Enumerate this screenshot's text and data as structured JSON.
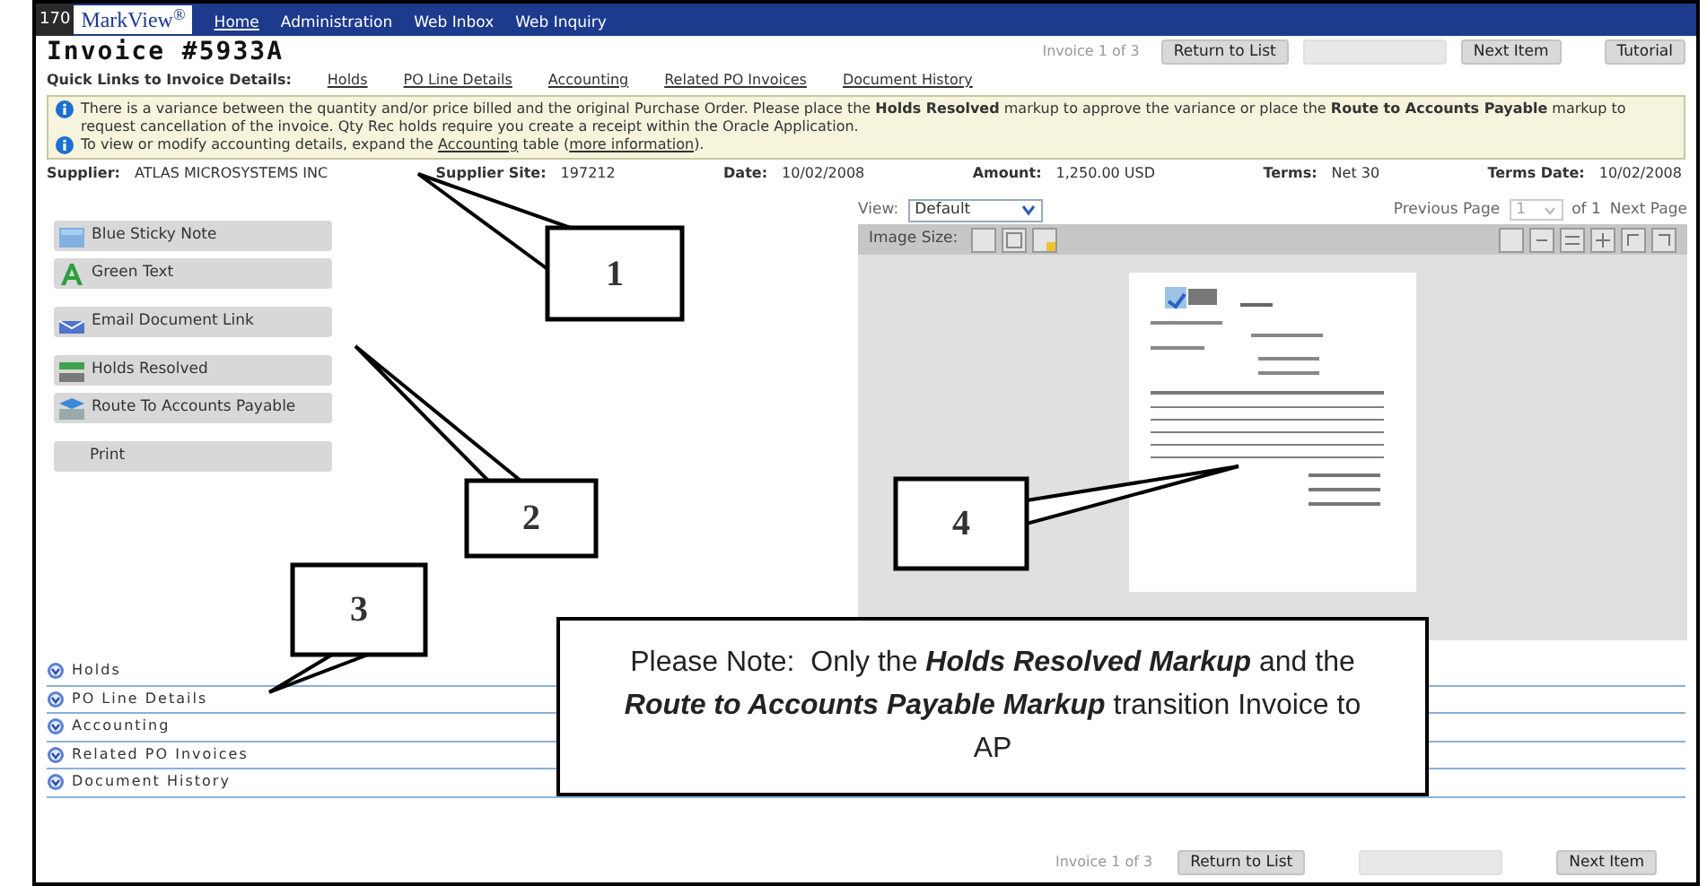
{
  "nav": {
    "logo_number": "170",
    "logo": "MarkView$^{®}$",
    "items": [
      {
        "label": "Home",
        "selected": true
      },
      {
        "label": "Administration",
        "selected": false
      },
      {
        "label": "Web Inbox",
        "selected": false
      },
      {
        "label": "Web Inquiry",
        "selected": false
      }
    ]
  },
  "header": {
    "title": "Invoice #5933A",
    "position": "Invoice 1 of 3",
    "buttons": [
      {
        "label": "Return to List",
        "disabled": false
      },
      {
        "disabled": true
      },
      {
        "label": "Next Item",
        "disabled": false
      },
      {
        "label": "Tutorial",
        "disabled": false
      }
    ]
  },
  "quick_links": {
    "label": "Quick Links to Invoice Details:",
    "links": [
      "Holds",
      "PO Line Details",
      "Accounting",
      "Related PO Invoices",
      "Document History"
    ]
  },
  "notices": [
    {
      "segments": [
        {
          "kind": "text",
          "text": "There is a variance between the quantity and/or price billed and the original Purchase Order. Please place the **Holds Resolved** markup to approve the variance or place the **Route to Accounts Payable** markup to request cancellation of the invoice. Qty Rec holds require you create a receipt within the Oracle Application."
        }
      ]
    },
    {
      "segments": [
        {
          "kind": "text",
          "text": "To view or modify accounting details, expand the "
        },
        {
          "kind": "link",
          "text": "Accounting"
        },
        {
          "kind": "text",
          "text": " table ("
        },
        {
          "kind": "link",
          "text": "more information"
        },
        {
          "kind": "text",
          "text": ")."
        }
      ]
    }
  ],
  "summary": [
    {
      "label": "Supplier:",
      "value": "ATLAS MICROSYSTEMS INC"
    },
    {
      "label": "Supplier Site:",
      "value": "197212"
    },
    {
      "label": "Date:",
      "value": "10/02/2008"
    },
    {
      "label": "Amount:",
      "value": "1,250.00 USD"
    },
    {
      "label": "Terms:",
      "value": "Net 30"
    },
    {
      "label": "Terms Date:",
      "value": "10/02/2008"
    }
  ],
  "markup_groups": [
    {
      "items": [
        {
          "label": "Blue Sticky Note",
          "kind": "sticky"
        },
        {
          "label": "Green Text",
          "kind": "text"
        }
      ]
    },
    {
      "items": [
        {
          "label": "Email Document Link",
          "kind": "email"
        }
      ]
    },
    {
      "items": [
        {
          "label": "Holds Resolved",
          "kind": "resolved"
        },
        {
          "label": "Route To Accounts Payable",
          "kind": "route"
        }
      ]
    },
    {
      "items": [
        {
          "label": "Print",
          "kind": "print"
        }
      ]
    }
  ],
  "viewer": {
    "view_label": "View:",
    "view_value": "Default",
    "previous": "Previous Page",
    "page": "1",
    "page_count": "of 1",
    "next": "Next Page",
    "image_size_label": "Image Size:"
  },
  "sections": [
    {
      "label": "Holds"
    },
    {
      "label": "PO Line Details"
    },
    {
      "label": "Accounting"
    },
    {
      "label": "Related PO Invoices"
    },
    {
      "label": "Document History"
    }
  ],
  "footer": {
    "position": "Invoice 1 of 3",
    "buttons": [
      {
        "label": "Return to List",
        "disabled": false
      },
      {
        "disabled": true
      },
      {
        "label": "Next Item",
        "disabled": false
      }
    ]
  },
  "callouts": [
    {
      "label": "1"
    },
    {
      "label": "2"
    },
    {
      "label": "3"
    },
    {
      "label": "4"
    }
  ],
  "note": {
    "text": "Please Note:  Only the **Holds Resolved Markup** and the **Route to Accounts Payable Markup** transition Invoice to AP"
  }
}
